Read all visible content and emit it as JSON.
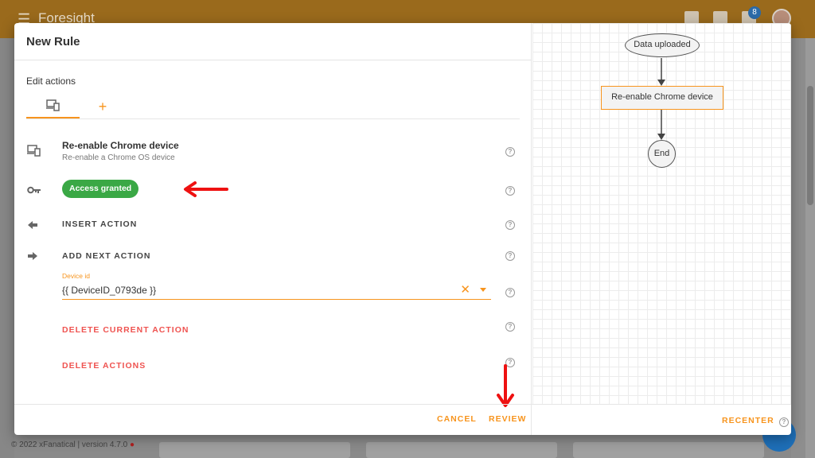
{
  "app": {
    "brand": "Foresight",
    "notification_count": "8",
    "footer": "© 2022 xFanatical | version 4.7.0"
  },
  "dialog": {
    "title": "New Rule",
    "section_title": "Edit actions",
    "tabs": [
      {
        "icon": "devices-icon",
        "selected": true
      },
      {
        "label": "+",
        "icon": "add-icon",
        "selected": false
      }
    ],
    "action": {
      "title": "Re-enable Chrome device",
      "subtitle": "Re-enable a Chrome OS device"
    },
    "access_chip": "Access granted",
    "insert_action": "INSERT ACTION",
    "add_next_action": "ADD NEXT ACTION",
    "device_field": {
      "label": "Device id",
      "value": "{{ DeviceID_0793de }}"
    },
    "delete_current_action": "DELETE CURRENT ACTION",
    "delete_actions": "DELETE ACTIONS",
    "cancel": "CANCEL",
    "review": "REVIEW"
  },
  "flow": {
    "nodes": [
      "Data uploaded",
      "Re-enable Chrome device",
      "End"
    ],
    "recenter": "RECENTER"
  },
  "colors": {
    "accent": "#f7941d",
    "success": "#3aa845",
    "danger": "#ef5350",
    "annotation_arrow": "#ee1111"
  }
}
